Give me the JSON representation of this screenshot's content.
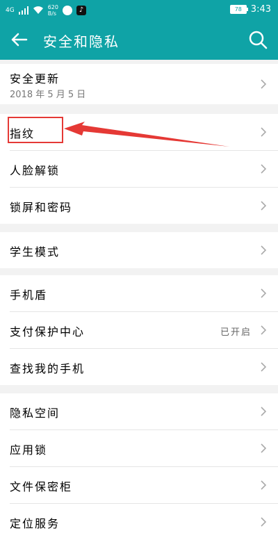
{
  "status_bar": {
    "network": "4G",
    "speed_value": "620",
    "speed_unit": "B/s",
    "battery": "78",
    "time": "3:43"
  },
  "header": {
    "title": "安全和隐私",
    "back_icon": "arrow-left-icon",
    "search_icon": "search-icon"
  },
  "groups": [
    {
      "items": [
        {
          "label": "安全更新",
          "sub": "2018 年 5 月 5 日"
        }
      ]
    },
    {
      "items": [
        {
          "label": "指纹"
        },
        {
          "label": "人脸解锁"
        },
        {
          "label": "锁屏和密码"
        }
      ]
    },
    {
      "items": [
        {
          "label": "学生模式"
        }
      ]
    },
    {
      "items": [
        {
          "label": "手机盾"
        },
        {
          "label": "支付保护中心",
          "status": "已开启"
        },
        {
          "label": "查找我的手机"
        }
      ]
    },
    {
      "items": [
        {
          "label": "隐私空间"
        },
        {
          "label": "应用锁"
        },
        {
          "label": "文件保密柜"
        },
        {
          "label": "定位服务"
        }
      ]
    }
  ],
  "annotation": {
    "color": "#e53935"
  },
  "colors": {
    "accent": "#0fa3a6"
  }
}
